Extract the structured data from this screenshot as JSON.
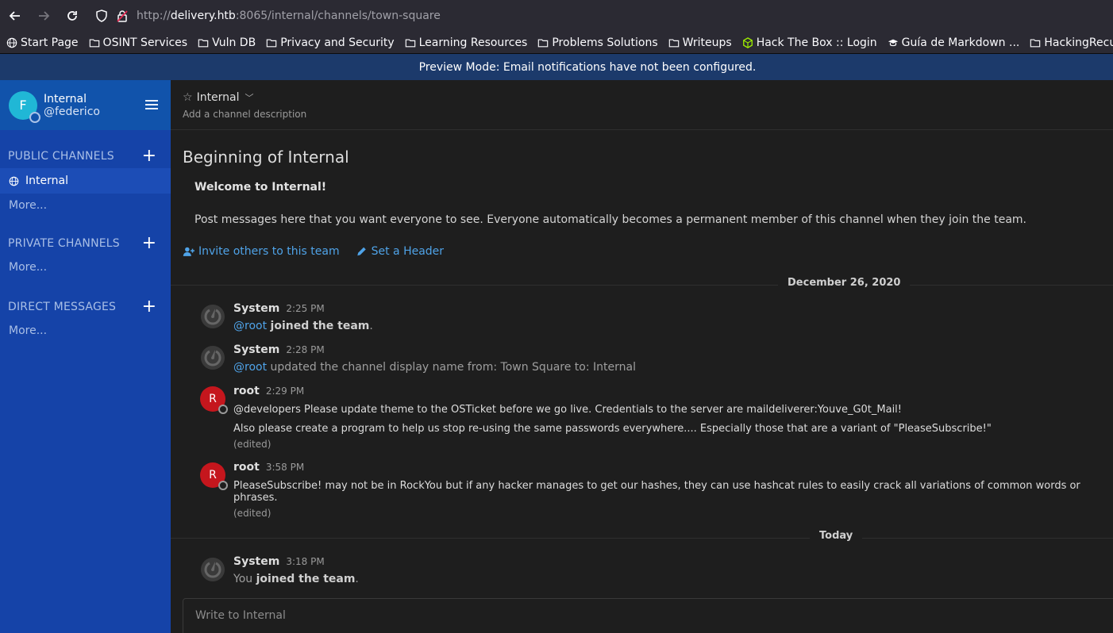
{
  "browser": {
    "url_prefix": "http://",
    "url_host": "delivery.htb",
    "url_rest": ":8065/internal/channels/town-square",
    "bookmarks": [
      "Start Page",
      "OSINT Services",
      "Vuln DB",
      "Privacy and Security",
      "Learning Resources",
      "Problems Solutions",
      "Writeups",
      "Hack The Box :: Login",
      "Guía de Markdown ...",
      "HackingRecursos"
    ]
  },
  "banner": {
    "text": "Preview Mode: Email notifications have not been configured."
  },
  "sidebar": {
    "avatar_letter": "F",
    "team_name": "Internal",
    "username": "@federico",
    "public_title": "PUBLIC CHANNELS",
    "public_channels": [
      {
        "label": "Internal"
      }
    ],
    "public_more": "More...",
    "private_title": "PRIVATE CHANNELS",
    "private_more": "More...",
    "dm_title": "DIRECT MESSAGES",
    "dm_more": "More...",
    "plus": "+"
  },
  "channel": {
    "name": "Internal",
    "description": "Add a channel description",
    "intro_title": "Beginning of Internal",
    "welcome": "Welcome to Internal!",
    "welcome_body": "Post messages here that you want everyone to see. Everyone automatically becomes a permanent member of this channel when they join the team.",
    "invite_label": "Invite others to this team",
    "header_label": "Set a Header"
  },
  "posts": {
    "date1": "December 26, 2020",
    "p1": {
      "user": "System",
      "time": "2:25 PM",
      "mention": "@root",
      "text": "joined the team",
      "suffix": "."
    },
    "p2": {
      "user": "System",
      "time": "2:28 PM",
      "mention": "@root",
      "text": "updated the channel display name from: Town Square to: Internal"
    },
    "p3": {
      "user": "root",
      "avatar": "R",
      "time": "2:29 PM",
      "line1": "@developers Please update theme to the OSTicket before we go live.  Credentials to the server are maildeliverer:Youve_G0t_Mail!",
      "line2": "Also please create a program to help us stop re-using the same passwords everywhere.... Especially those that are a variant of \"PleaseSubscribe!\"",
      "edited": "(edited)"
    },
    "p4": {
      "user": "root",
      "avatar": "R",
      "time": "3:58 PM",
      "line1": "PleaseSubscribe! may not be in RockYou but if any hacker manages to get our hashes, they can use hashcat rules to easily crack all variations of common words or phrases.",
      "edited": "(edited)"
    },
    "date2": "Today",
    "p5": {
      "user": "System",
      "time": "3:18 PM",
      "prefix": "You",
      "text": "joined the team",
      "suffix": "."
    }
  },
  "composer": {
    "placeholder": "Write to Internal"
  },
  "colors": {
    "sidebar": "#1543a8",
    "banner": "#1c3a6b",
    "link": "#4fa3e8",
    "root_avatar": "#c5161d",
    "team_avatar": "#20b7d6"
  }
}
